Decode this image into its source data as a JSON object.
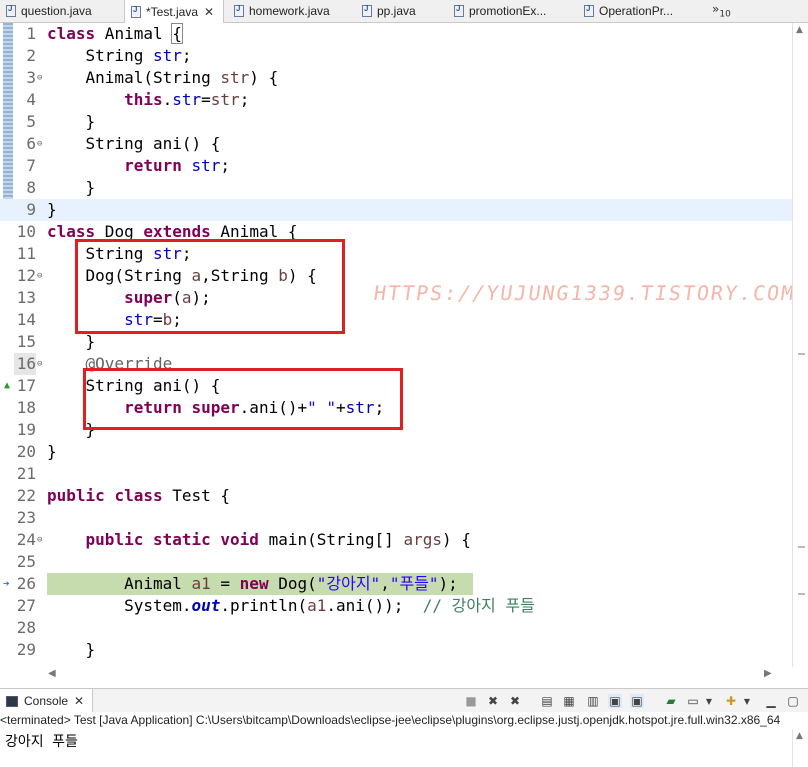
{
  "tabs": [
    {
      "label": "question.java",
      "active": false
    },
    {
      "label": "*Test.java",
      "active": true
    },
    {
      "label": "homework.java",
      "active": false
    },
    {
      "label": "pp.java",
      "active": false
    },
    {
      "label": "promotionEx...",
      "active": false
    },
    {
      "label": "OperationPr...",
      "active": false
    }
  ],
  "overflow": {
    "chevron": "»",
    "count": "10"
  },
  "watermark": "HTTPS://YUJUNG1339.TISTORY.COM/",
  "lines": [
    {
      "n": "1"
    },
    {
      "n": "2"
    },
    {
      "n": "3"
    },
    {
      "n": "4"
    },
    {
      "n": "5"
    },
    {
      "n": "6"
    },
    {
      "n": "7"
    },
    {
      "n": "8"
    },
    {
      "n": "9"
    },
    {
      "n": "10"
    },
    {
      "n": "11"
    },
    {
      "n": "12"
    },
    {
      "n": "13"
    },
    {
      "n": "14"
    },
    {
      "n": "15"
    },
    {
      "n": "16"
    },
    {
      "n": "17"
    },
    {
      "n": "18"
    },
    {
      "n": "19"
    },
    {
      "n": "20"
    },
    {
      "n": "21"
    },
    {
      "n": "22"
    },
    {
      "n": "23"
    },
    {
      "n": "24"
    },
    {
      "n": "25"
    },
    {
      "n": "26"
    },
    {
      "n": "27"
    },
    {
      "n": "28"
    },
    {
      "n": "29"
    }
  ],
  "code": {
    "l1_kw": "class",
    "l1_rest": " Animal ",
    "l1_brace": "{",
    "l2_type": "    String ",
    "l2_fld": "str",
    "l2_end": ";",
    "l3_a": "    Animal(String ",
    "l3_prm": "str",
    "l3_b": ") {",
    "l4_kw": "this",
    "l4_dot": ".",
    "l4_fld": "str",
    "l4_eq": "=",
    "l4_prm": "str",
    "l4_end": ";",
    "l5": "    }",
    "l6": "    String ani() {",
    "l7_kw": "return",
    "l7_fld": "str",
    "l7_end": ";",
    "l8": "    }",
    "l9": "}",
    "l10_kw1": "class",
    "l10_mid": " Dog ",
    "l10_kw2": "extends",
    "l10_end": " Animal {",
    "l11_type": "    String ",
    "l11_fld": "str",
    "l11_end": ";",
    "l12_a": "    Dog(String ",
    "l12_p1": "a",
    "l12_b": ",String ",
    "l12_p2": "b",
    "l12_c": ") {",
    "l13_kw": "super",
    "l13_a": "(",
    "l13_prm": "a",
    "l13_b": ");",
    "l14_fld": "str",
    "l14_eq": "=",
    "l14_prm": "b",
    "l14_end": ";",
    "l15": "    }",
    "l16_ann": "@Override",
    "l17": "    String ani() {",
    "l18_kw1": "return",
    "l18_kw2": "super",
    "l18_a": ".ani()+",
    "l18_str": "\" \"",
    "l18_b": "+",
    "l18_fld": "str",
    "l18_end": ";",
    "l19": "    }",
    "l20": "}",
    "l22_kw1": "public",
    "l22_kw2": "class",
    "l22_end": " Test {",
    "l24_kw1": "public",
    "l24_kw2": "static",
    "l24_kw3": "void",
    "l24_a": " main(String[] ",
    "l24_prm": "args",
    "l24_b": ") {",
    "l26_a": "Animal ",
    "l26_var": "a1",
    "l26_b": " = ",
    "l26_kw": "new",
    "l26_c": " Dog(",
    "l26_s1": "\"강아지\"",
    "l26_d": ",",
    "l26_s2": "\"푸들\"",
    "l26_e": ");",
    "l27_a": "System.",
    "l27_out": "out",
    "l27_b": ".println(",
    "l27_var": "a1",
    "l27_c": ".ani());  ",
    "l27_cmt": "// 강아지 푸들",
    "l29": "    }"
  },
  "console": {
    "tab_label": "Console",
    "status": "<terminated> Test [Java Application] C:\\Users\\bitcamp\\Downloads\\eclipse-jee\\eclipse\\plugins\\org.eclipse.justj.openjdk.hotspot.jre.full.win32.x86_64",
    "output": "강아지 푸들"
  },
  "colors": {
    "keyword": "#7f0055",
    "field": "#0000c0",
    "string": "#2a00ff",
    "comment": "#3f7f5f",
    "highlight": "#e02020",
    "debug_line": "#c6dbae"
  }
}
